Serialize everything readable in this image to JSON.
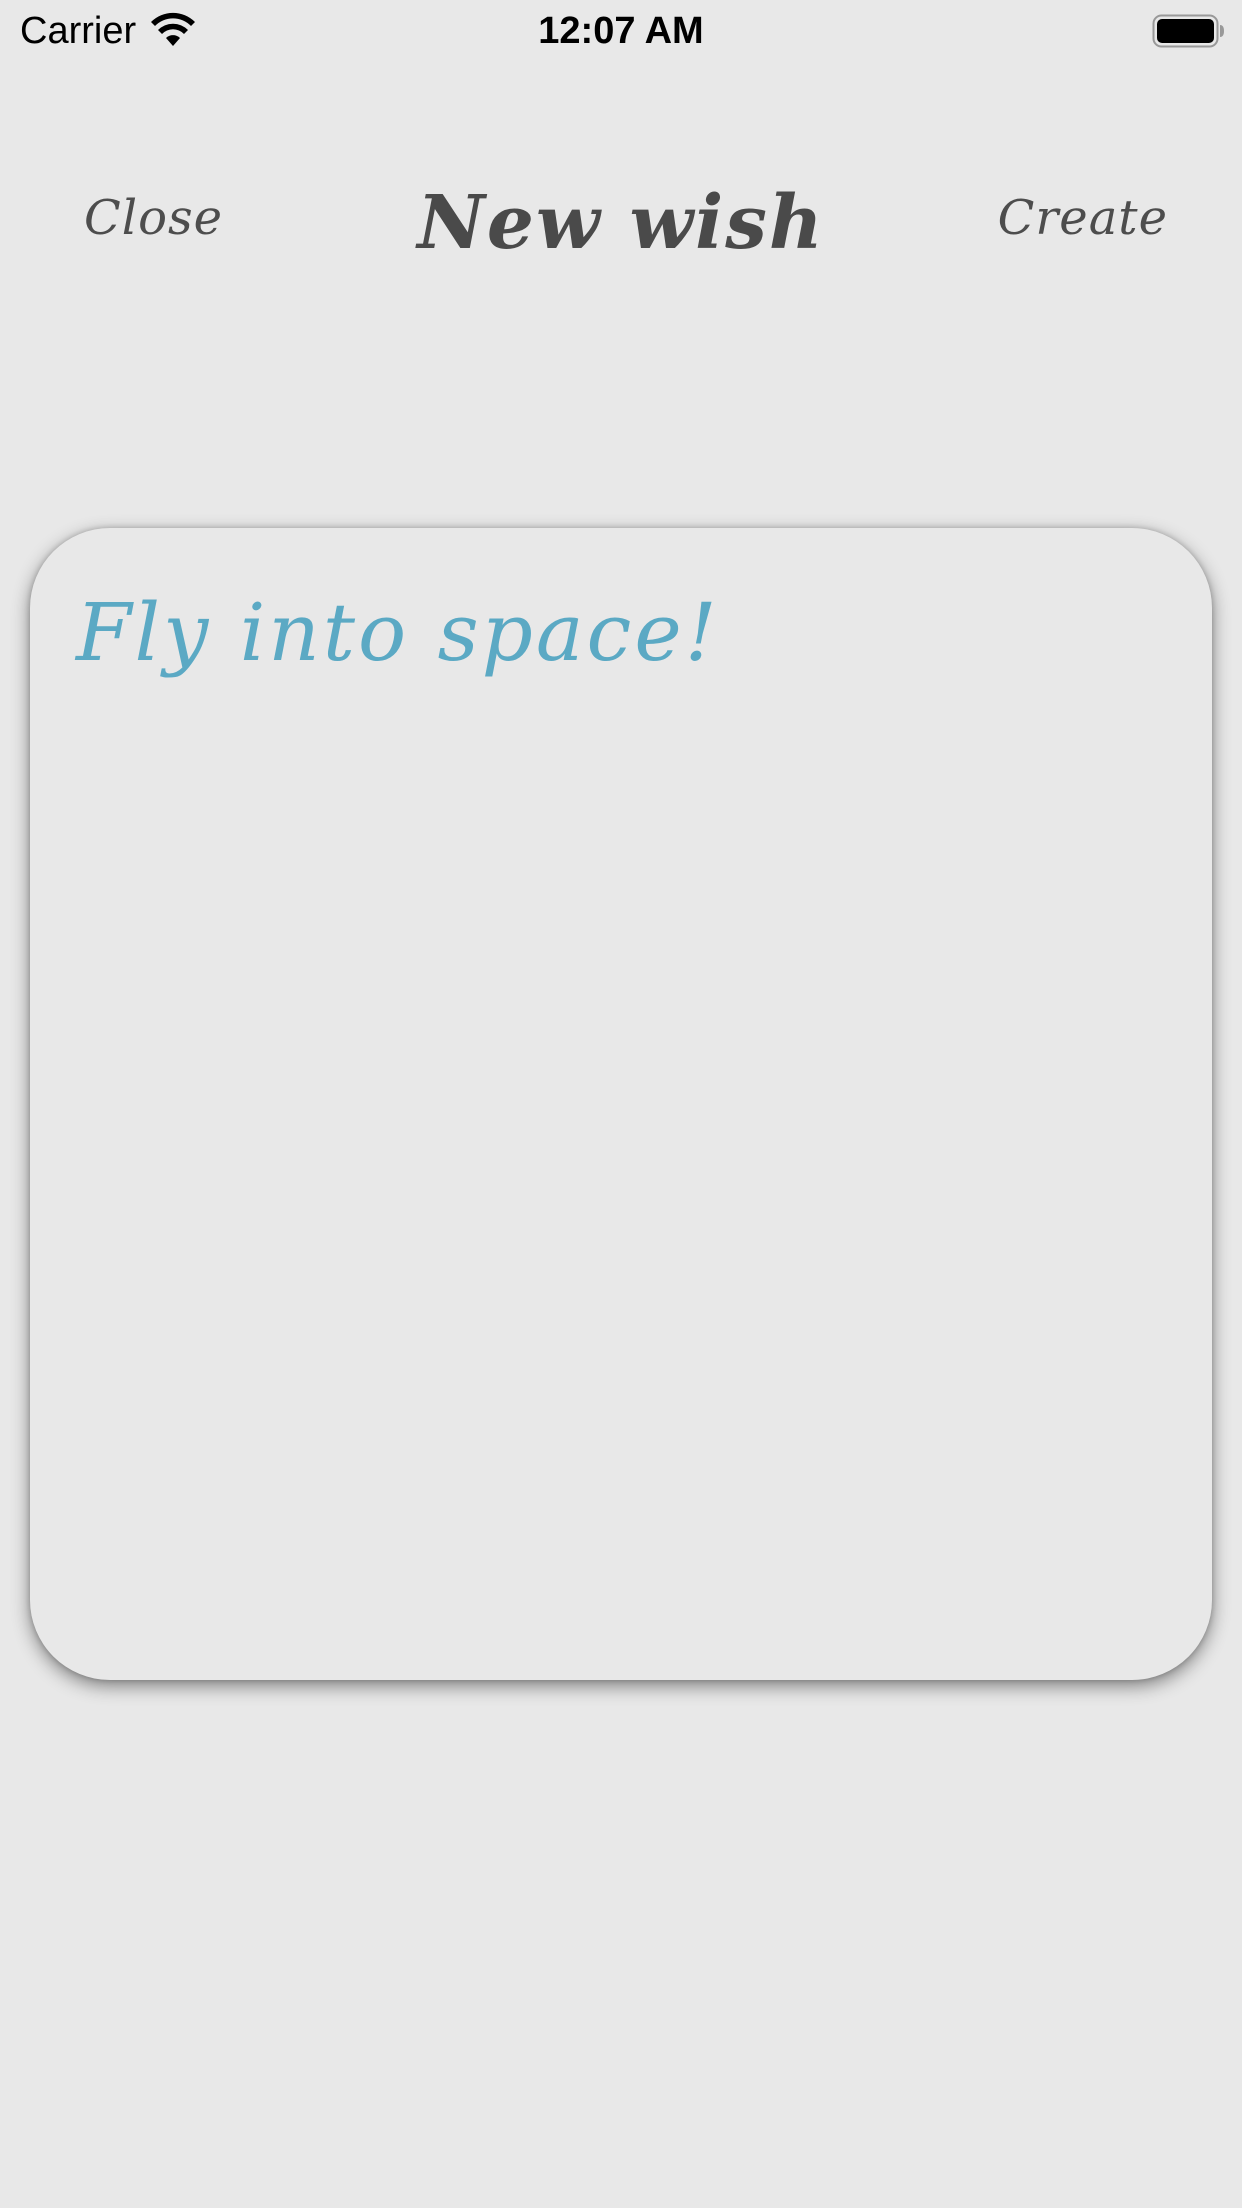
{
  "status_bar": {
    "carrier": "Carrier",
    "time": "12:07 AM",
    "wifi_icon": "wifi-icon",
    "battery_icon": "battery-full-icon"
  },
  "nav": {
    "close_label": "Close",
    "title": "New wish",
    "create_label": "Create"
  },
  "wish": {
    "text": "Fly into space!"
  },
  "colors": {
    "background": "#e8e8e8",
    "nav_text": "#4a4a4a",
    "wish_text": "#5ba9c4"
  }
}
